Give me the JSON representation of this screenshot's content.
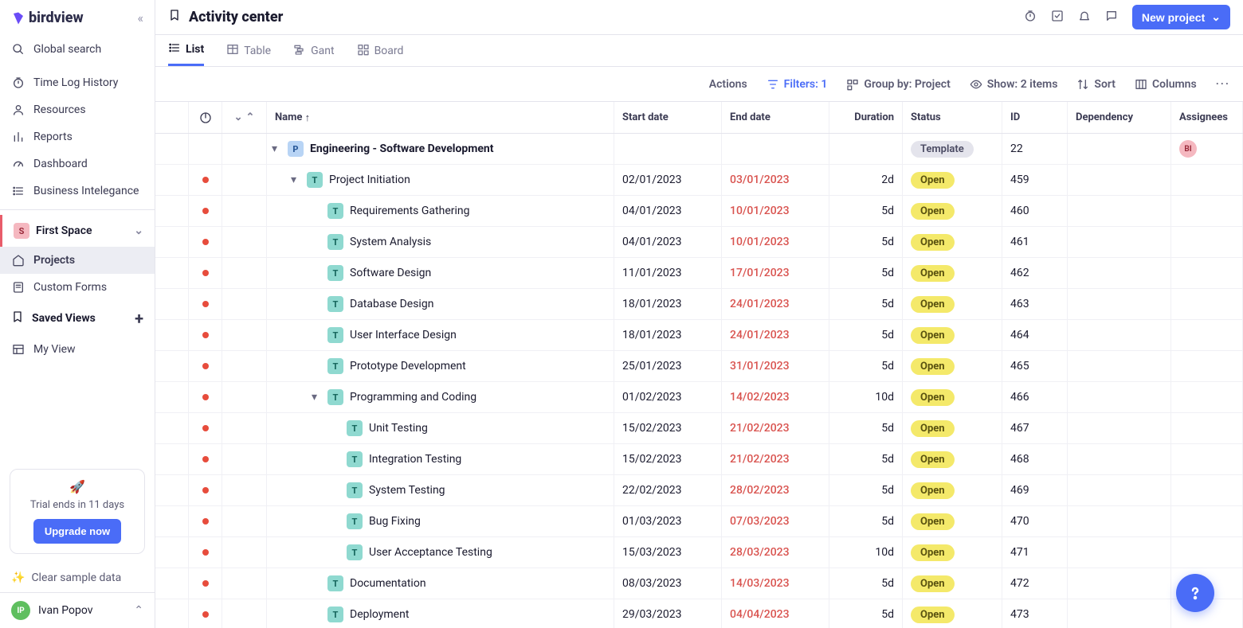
{
  "brand": "birdview",
  "sidebar": {
    "global_search": "Global search",
    "nav": [
      {
        "label": "Time Log History",
        "icon": "stopwatch"
      },
      {
        "label": "Resources",
        "icon": "user"
      },
      {
        "label": "Reports",
        "icon": "bars"
      },
      {
        "label": "Dashboard",
        "icon": "gauge"
      },
      {
        "label": "Business Intelegance",
        "icon": "list"
      }
    ],
    "space": {
      "badge": "S",
      "name": "First Space"
    },
    "sub": [
      {
        "label": "Projects",
        "icon": "home",
        "active": true
      },
      {
        "label": "Custom Forms",
        "icon": "form"
      }
    ],
    "saved_views_header": "Saved Views",
    "saved_views": [
      {
        "label": "My View",
        "icon": "layout"
      }
    ],
    "trial": {
      "text": "Trial ends in 11 days",
      "button": "Upgrade now"
    },
    "clear_sample": "Clear sample data",
    "user": {
      "initials": "IP",
      "name": "Ivan Popov"
    }
  },
  "header": {
    "title": "Activity center",
    "new_project": "New project"
  },
  "view_tabs": [
    {
      "label": "List",
      "icon": "list",
      "active": true
    },
    {
      "label": "Table",
      "icon": "table"
    },
    {
      "label": "Gant",
      "icon": "gant"
    },
    {
      "label": "Board",
      "icon": "board"
    }
  ],
  "toolbar": {
    "actions": "Actions",
    "filters": "Filters: 1",
    "group_by": "Group by: Project",
    "show": "Show: 2 items",
    "sort": "Sort",
    "columns": "Columns"
  },
  "columns": {
    "name": "Name",
    "start": "Start date",
    "end": "End date",
    "duration": "Duration",
    "status": "Status",
    "id": "ID",
    "dependency": "Dependency",
    "assignees": "Assignees"
  },
  "rows": [
    {
      "type": "P",
      "indent": 0,
      "caret": true,
      "name": "Engineering - Software Development",
      "start": "",
      "end": "",
      "duration": "",
      "status": "Template",
      "id": "22",
      "dep": "",
      "assn": "BI",
      "dot": false,
      "bold": true
    },
    {
      "type": "T",
      "indent": 1,
      "caret": true,
      "name": "Project Initiation",
      "start": "02/01/2023",
      "end": "03/01/2023",
      "duration": "2d",
      "status": "Open",
      "id": "459",
      "dep": "",
      "assn": "",
      "dot": true
    },
    {
      "type": "T",
      "indent": 2,
      "caret": false,
      "name": "Requirements Gathering",
      "start": "04/01/2023",
      "end": "10/01/2023",
      "duration": "5d",
      "status": "Open",
      "id": "460",
      "dep": "",
      "assn": "",
      "dot": true
    },
    {
      "type": "T",
      "indent": 2,
      "caret": false,
      "name": "System Analysis",
      "start": "04/01/2023",
      "end": "10/01/2023",
      "duration": "5d",
      "status": "Open",
      "id": "461",
      "dep": "",
      "assn": "",
      "dot": true
    },
    {
      "type": "T",
      "indent": 2,
      "caret": false,
      "name": "Software Design",
      "start": "11/01/2023",
      "end": "17/01/2023",
      "duration": "5d",
      "status": "Open",
      "id": "462",
      "dep": "",
      "assn": "",
      "dot": true
    },
    {
      "type": "T",
      "indent": 2,
      "caret": false,
      "name": "Database Design",
      "start": "18/01/2023",
      "end": "24/01/2023",
      "duration": "5d",
      "status": "Open",
      "id": "463",
      "dep": "",
      "assn": "",
      "dot": true
    },
    {
      "type": "T",
      "indent": 2,
      "caret": false,
      "name": "User Interface Design",
      "start": "18/01/2023",
      "end": "24/01/2023",
      "duration": "5d",
      "status": "Open",
      "id": "464",
      "dep": "",
      "assn": "",
      "dot": true
    },
    {
      "type": "T",
      "indent": 2,
      "caret": false,
      "name": "Prototype Development",
      "start": "25/01/2023",
      "end": "31/01/2023",
      "duration": "5d",
      "status": "Open",
      "id": "465",
      "dep": "",
      "assn": "",
      "dot": true
    },
    {
      "type": "T",
      "indent": 2,
      "caret": true,
      "name": "Programming and Coding",
      "start": "01/02/2023",
      "end": "14/02/2023",
      "duration": "10d",
      "status": "Open",
      "id": "466",
      "dep": "",
      "assn": "",
      "dot": true
    },
    {
      "type": "T",
      "indent": 3,
      "caret": false,
      "name": "Unit Testing",
      "start": "15/02/2023",
      "end": "21/02/2023",
      "duration": "5d",
      "status": "Open",
      "id": "467",
      "dep": "",
      "assn": "",
      "dot": true
    },
    {
      "type": "T",
      "indent": 3,
      "caret": false,
      "name": "Integration Testing",
      "start": "15/02/2023",
      "end": "21/02/2023",
      "duration": "5d",
      "status": "Open",
      "id": "468",
      "dep": "",
      "assn": "",
      "dot": true
    },
    {
      "type": "T",
      "indent": 3,
      "caret": false,
      "name": "System Testing",
      "start": "22/02/2023",
      "end": "28/02/2023",
      "duration": "5d",
      "status": "Open",
      "id": "469",
      "dep": "",
      "assn": "",
      "dot": true
    },
    {
      "type": "T",
      "indent": 3,
      "caret": false,
      "name": "Bug Fixing",
      "start": "01/03/2023",
      "end": "07/03/2023",
      "duration": "5d",
      "status": "Open",
      "id": "470",
      "dep": "",
      "assn": "",
      "dot": true
    },
    {
      "type": "T",
      "indent": 3,
      "caret": false,
      "name": "User Acceptance Testing",
      "start": "15/03/2023",
      "end": "28/03/2023",
      "duration": "10d",
      "status": "Open",
      "id": "471",
      "dep": "",
      "assn": "",
      "dot": true
    },
    {
      "type": "T",
      "indent": 2,
      "caret": false,
      "name": "Documentation",
      "start": "08/03/2023",
      "end": "14/03/2023",
      "duration": "5d",
      "status": "Open",
      "id": "472",
      "dep": "",
      "assn": "",
      "dot": true
    },
    {
      "type": "T",
      "indent": 2,
      "caret": false,
      "name": "Deployment",
      "start": "29/03/2023",
      "end": "04/04/2023",
      "duration": "5d",
      "status": "Open",
      "id": "473",
      "dep": "",
      "assn": "",
      "dot": true
    }
  ]
}
